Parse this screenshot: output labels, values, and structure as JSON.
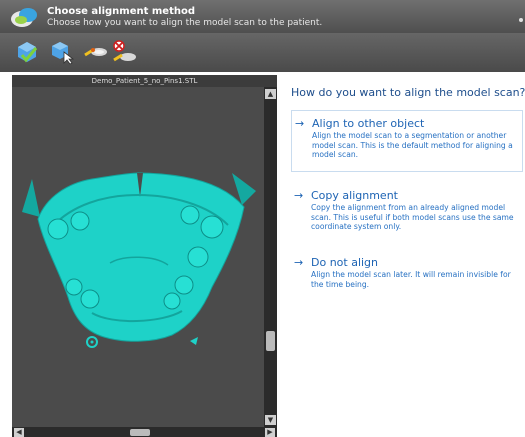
{
  "header": {
    "title": "Choose alignment method",
    "subtitle": "Choose how you want to align the model scan to the patient."
  },
  "toolbar": {
    "icons": [
      "model-scan-check-icon",
      "model-scan-select-icon",
      "align-tool-icon",
      "remove-alignment-icon"
    ]
  },
  "viewport": {
    "title": "Demo_Patient_5_no_Pins1.STL",
    "model_color": "#1ed2c8"
  },
  "panel": {
    "question": "How do you want to align the model scan?",
    "options": [
      {
        "arrow": "→",
        "title": "Align to other object",
        "description": "Align the model scan to a segmentation or another model scan. This is the default method for aligning a model scan.",
        "selected": true
      },
      {
        "arrow": "→",
        "title": "Copy alignment",
        "description": "Copy the alignment from an already aligned model scan. This is useful if both model scans use the same coordinate system only."
      },
      {
        "arrow": "→",
        "title": "Do not align",
        "description": "Align the model scan later. It will remain invisible for the time being."
      }
    ]
  },
  "colors": {
    "link": "#1e64b4",
    "header_bg": "#5a5a5a",
    "viewport_bg": "#4b4b4b"
  }
}
